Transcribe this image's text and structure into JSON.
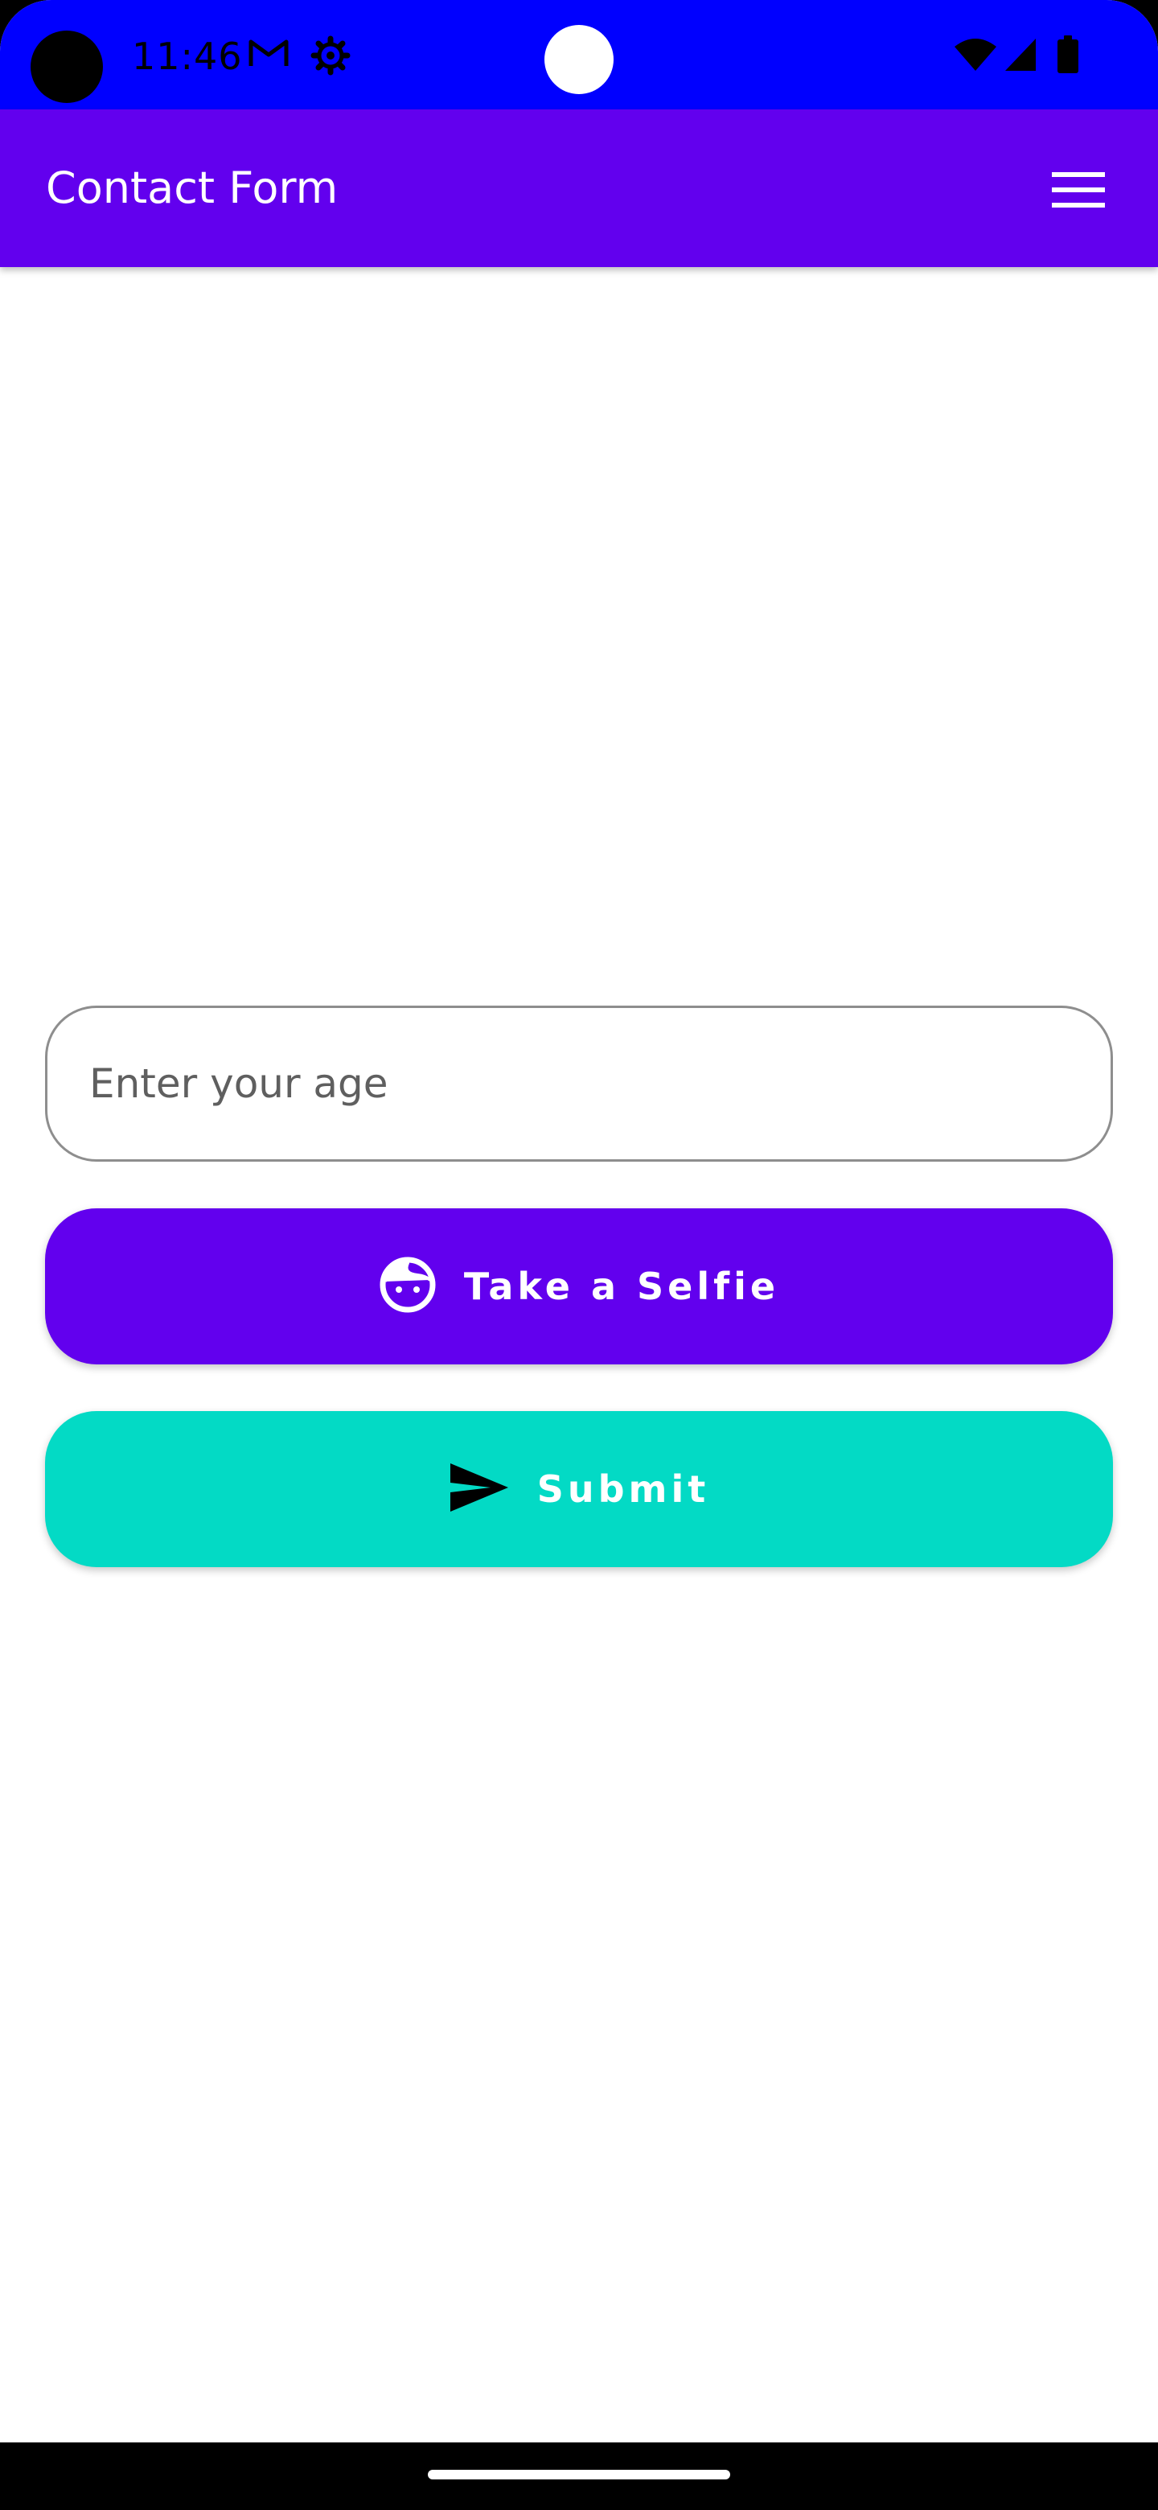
{
  "status_bar": {
    "time": "11:46",
    "icons": [
      "gmail-icon",
      "settings-icon",
      "wifi-icon",
      "cellular-signal-icon",
      "battery-icon"
    ]
  },
  "app_bar": {
    "title": "Contact Form",
    "menu_icon": "hamburger-menu-icon"
  },
  "form": {
    "age_input": {
      "placeholder": "Enter your age",
      "value": ""
    },
    "selfie_button": {
      "label": "Take a Selfie",
      "icon": "face-icon"
    },
    "submit_button": {
      "label": "Submit",
      "icon": "send-icon"
    }
  },
  "colors": {
    "status_bar": "#0000FF",
    "primary": "#6200EE",
    "secondary": "#03DAC5",
    "background": "#FFFFFF"
  }
}
